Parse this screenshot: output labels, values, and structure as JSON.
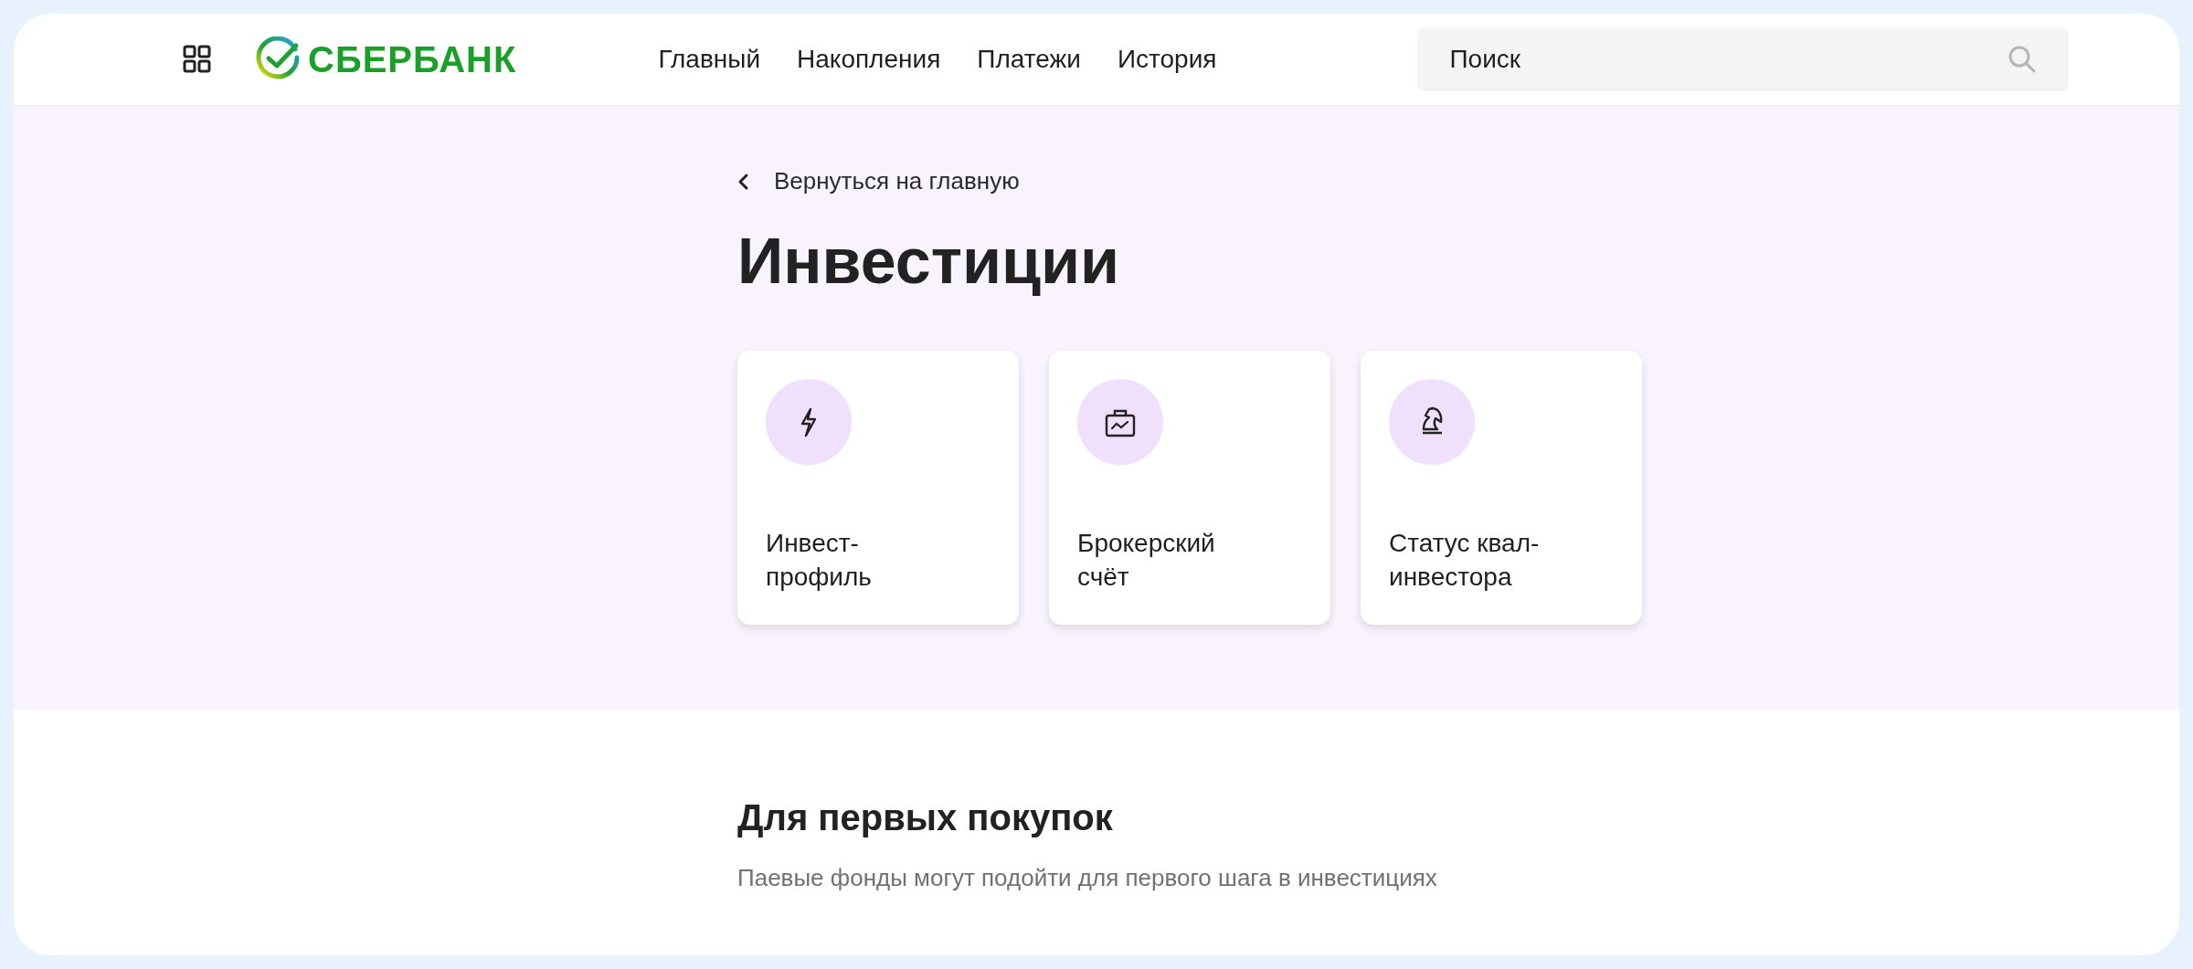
{
  "header": {
    "logo_text": "СБЕРБАНК",
    "nav": [
      {
        "label": "Главный"
      },
      {
        "label": "Накопления"
      },
      {
        "label": "Платежи"
      },
      {
        "label": "История"
      }
    ],
    "search": {
      "placeholder": "Поиск"
    }
  },
  "hero": {
    "back_link": "Вернуться на главную",
    "title": "Инвестиции",
    "cards": [
      {
        "kind": "lightning",
        "label": "Инвест-\nпрофиль"
      },
      {
        "kind": "briefcase",
        "label": "Брокерский\nсчёт"
      },
      {
        "kind": "knight",
        "label": "Статус квал-\nинвестора"
      }
    ]
  },
  "section": {
    "title": "Для первых покупок",
    "subtitle": "Паевые фонды могут подойти для первого шага в инвестициях"
  }
}
